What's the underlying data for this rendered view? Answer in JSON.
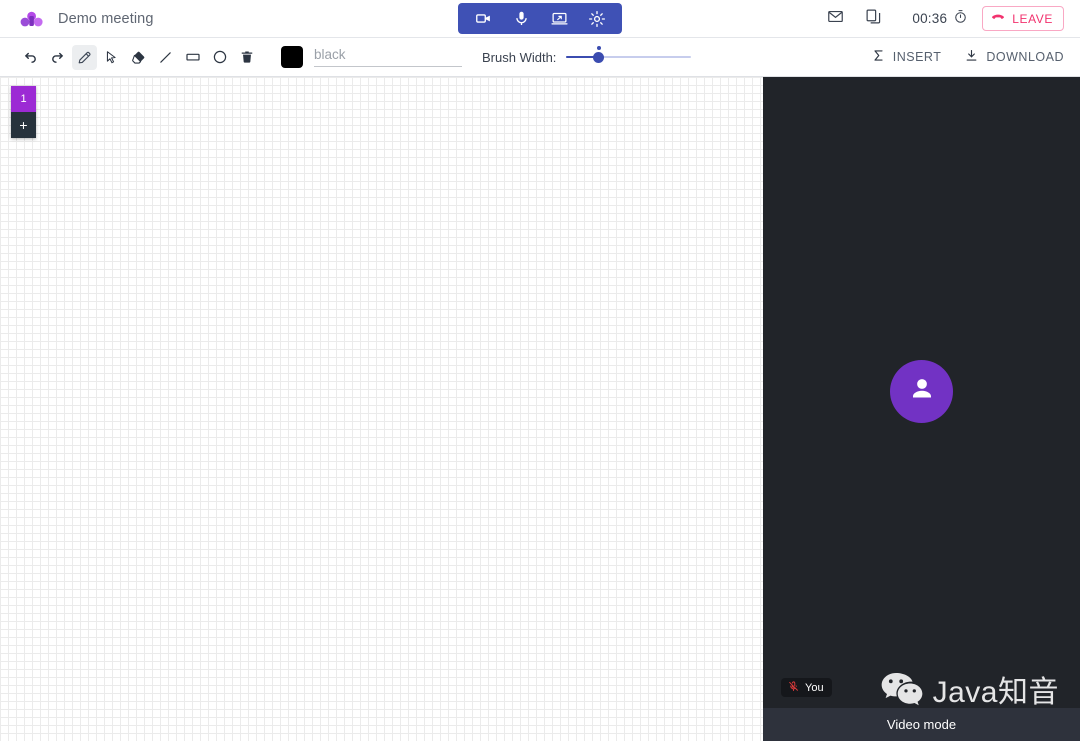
{
  "header": {
    "brand_icon": "meetn-dots-logo",
    "title": "Demo meeting",
    "media_controls": [
      {
        "name": "camera",
        "icon": "video-camera-icon"
      },
      {
        "name": "microphone",
        "icon": "microphone-icon"
      },
      {
        "name": "screen-share",
        "icon": "screen-share-icon"
      },
      {
        "name": "settings",
        "icon": "gear-icon"
      }
    ],
    "mail_icon": "envelope-icon",
    "copy_icon": "copy-icon",
    "timer": "00:36",
    "timer_icon": "stopwatch-icon",
    "leave_label": "LEAVE",
    "leave_icon": "phone-hangup-icon",
    "accent_color": "#3f51b5",
    "leave_color": "#f2326e"
  },
  "toolbar": {
    "tools": [
      {
        "name": "undo",
        "icon": "undo-arrow-icon",
        "active": false
      },
      {
        "name": "redo",
        "icon": "redo-arrow-icon",
        "active": false
      },
      {
        "name": "pencil",
        "icon": "pencil-icon",
        "active": true
      },
      {
        "name": "select",
        "icon": "cursor-arrow-icon",
        "active": false
      },
      {
        "name": "eraser",
        "icon": "eraser-icon",
        "active": false
      },
      {
        "name": "line",
        "icon": "line-icon",
        "active": false
      },
      {
        "name": "rectangle",
        "icon": "rectangle-icon",
        "active": false
      },
      {
        "name": "ellipse",
        "icon": "circle-icon",
        "active": false
      },
      {
        "name": "delete",
        "icon": "trash-icon",
        "active": false
      }
    ],
    "color_value": "black",
    "color_hex": "#000000",
    "brush_label": "Brush Width:",
    "brush_percent": 26,
    "insert_label": "INSERT",
    "insert_icon": "sigma-icon",
    "download_label": "DOWNLOAD",
    "download_icon": "download-icon"
  },
  "board": {
    "pages": [
      {
        "label": "1",
        "active": true
      }
    ],
    "add_page_label": "+",
    "active_page_color": "#9c2ad4"
  },
  "video": {
    "avatar_icon": "person-icon",
    "avatar_color": "#7232c4",
    "self_label": "You",
    "self_mic_icon": "microphone-muted-icon",
    "watermark_icon": "wechat-icon",
    "watermark_text": "Java知音",
    "mode_label": "Video mode"
  }
}
